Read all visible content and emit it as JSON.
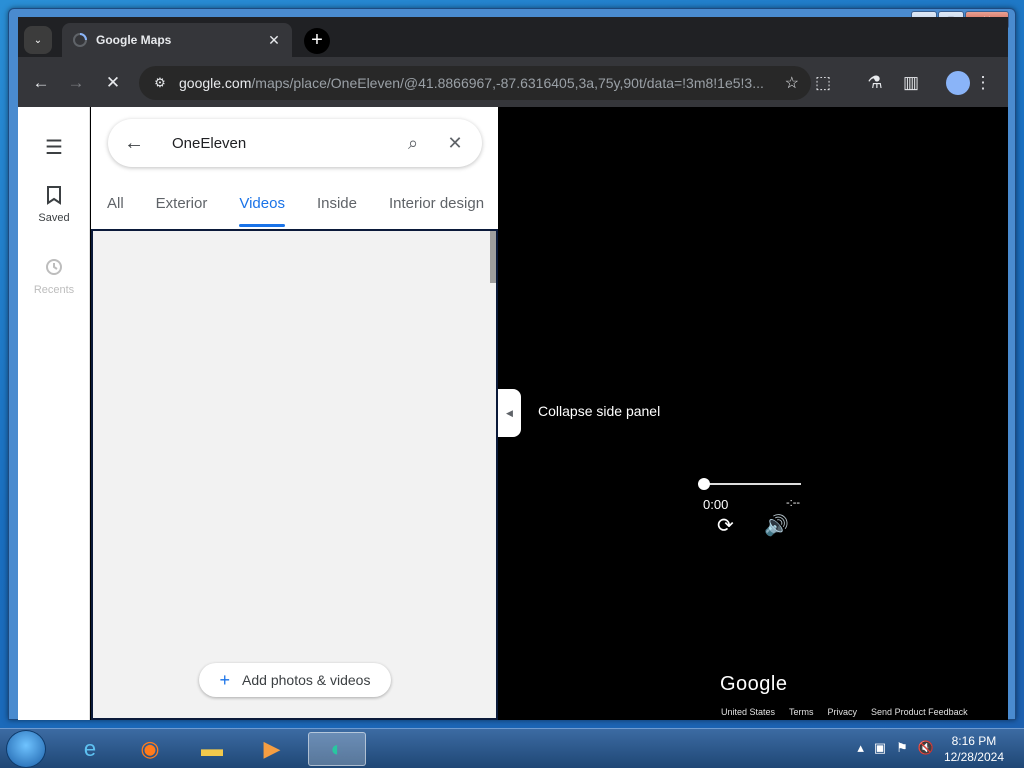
{
  "window": {
    "minimize": "▁",
    "maximize": "▢",
    "close": "✕"
  },
  "tab": {
    "title": "Google Maps",
    "close": "✕",
    "new_tab": "+"
  },
  "toolbar": {
    "url_host": "google.com",
    "url_path": "/maps/place/OneEleven/@41.8866967,-87.6316405,3a,75y,90t/data=!3m8!1e5!3..."
  },
  "rail": {
    "saved_label": "Saved",
    "recents_label": "Recents"
  },
  "search": {
    "value": "OneEleven"
  },
  "photo_tabs": [
    "All",
    "Exterior",
    "Videos",
    "Inside",
    "Interior design"
  ],
  "photo_tabs_active_index": 2,
  "panel": {
    "add_button_label": "Add photos & videos"
  },
  "collapse": {
    "tooltip": "Collapse side panel"
  },
  "player": {
    "current_time": "0:00",
    "duration": "-:--",
    "progress": 0
  },
  "map_footer": {
    "logo": "Google",
    "links": [
      "United States",
      "Terms",
      "Privacy",
      "Send Product Feedback"
    ]
  },
  "taskbar": {
    "time": "8:16 PM",
    "date": "12/28/2024"
  },
  "colors": {
    "accent": "#1a73e8",
    "chrome_dark": "#35363a",
    "video_bg": "#000000"
  },
  "icons": [
    "search-icon",
    "close-icon",
    "back-icon",
    "menu-icon",
    "bookmark-icon",
    "history-icon",
    "replay-icon",
    "volume-icon",
    "star-icon",
    "extension-icon",
    "lab-icon",
    "sidepanel-icon",
    "profile-icon",
    "kebab-icon",
    "reload-icon",
    "forward-icon"
  ]
}
